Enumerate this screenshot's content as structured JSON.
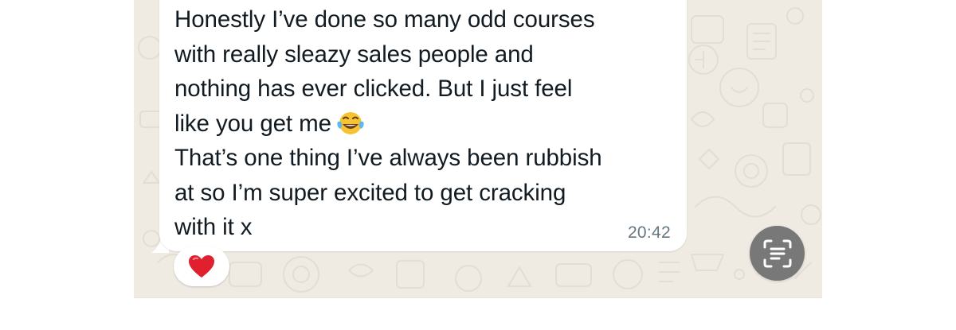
{
  "message": {
    "lines": [
      "Honestly I’ve done so many odd courses",
      "with really sleazy sales people and",
      "nothing has ever clicked. But I just feel",
      "like you get me",
      "That’s one thing I’ve always been rubbish",
      "at so I’m super excited to get cracking",
      "with it x"
    ],
    "inline_emoji": "face-with-tears-of-joy",
    "timestamp": "20:42"
  },
  "reaction": {
    "emoji": "red-heart"
  },
  "scan_button": {
    "icon": "text-scan-icon"
  },
  "colors": {
    "chat_background": "#efeae2",
    "bubble": "#ffffff",
    "text": "#111b21",
    "timestamp": "#667781",
    "scan_button": "#787878",
    "heart": "#e0202f"
  }
}
